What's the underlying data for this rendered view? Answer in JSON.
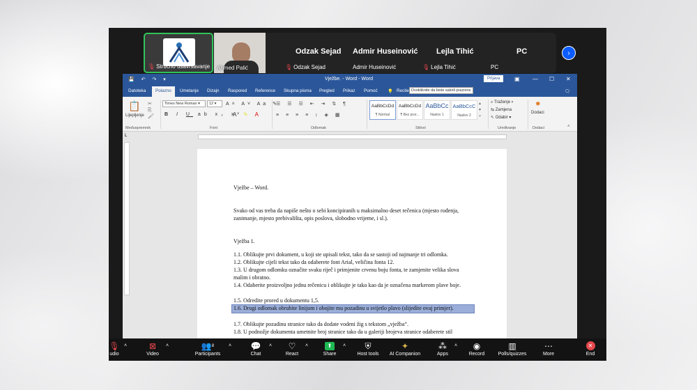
{
  "participants": {
    "tiles": [
      {
        "name": "Stručno usavršavanje"
      },
      {
        "name": "Ahmed Palić"
      }
    ],
    "names_big": [
      "Odzak Sejad",
      "Admir Huseinović",
      "Lejla Tihić",
      "PC"
    ],
    "names_small": [
      "Odzak Sejad",
      "Admir Huseinović",
      "Lejla Tihić",
      "PC"
    ],
    "next_icon": "chevron-right-icon"
  },
  "word": {
    "title": "Vježbe. - Word  -  Word",
    "signin": "Prijava",
    "tabs": [
      "Datoteka",
      "Polazno",
      "Umetanje",
      "Dizajn",
      "Raspored",
      "Reference",
      "Skupna pisma",
      "Pregled",
      "Prikaz",
      "Pomoć",
      "Recite što želite učiniti"
    ],
    "active_tab": "Polazno",
    "ribbon": {
      "paste": "Lijepljenje",
      "font_name": "Times New Roman",
      "font_size": "12",
      "groups": [
        "Međuspremnik",
        "Font",
        "Odlomak",
        "Stilovi",
        "Uređivanje",
        "Dodaci"
      ],
      "styles": [
        {
          "sample": "AaBbCcDd",
          "name": "¶ Normal"
        },
        {
          "sample": "AaBbCcDd",
          "name": "¶ Bez pror..."
        },
        {
          "sample": "AaBbCc",
          "name": "Naslov 1"
        },
        {
          "sample": "AaBbCcC",
          "name": "Naslov 2"
        }
      ],
      "editing": [
        "Traženje",
        "Zamjena",
        "Odabir"
      ],
      "addins": "Dodaci"
    },
    "tooltip": "Dvokliknite da biste sakrili praznine",
    "document": {
      "heading": "Vježbe – Word.",
      "intro": "Svako od vas treba da napiše nešto o sebi koncipiranih u maksimalno deset rečenica (mjesto rođenja, zanimanje, mjesto prebivališta, opis poslova, slobodno vrijeme, i sl.).",
      "section": "Vježba 1.",
      "items": [
        "1.1. Oblikujte prvi dokument, u koji ste upisali tekst, tako da se sastoji od najmanje tri odlomka.",
        "1.2. Oblikujte cijeli tekst tako da odaberete font Arial, veličina fonta 12.",
        "1.3. U drugom odlomku označite svaku riječ i primjenite crvenu boju fonta, te zamjenite velika slova malim i obratno.",
        "1.4. Odaberite proizvoljno jednu rečenicu i oblikujte je tako kao da je označena markerom plave boje.",
        "1.5. Odredite prored u dokumentu 1,5.",
        "1.6. Drugi odlomak obrubite linijom i obojite mu pozadinu u svijetlo plavo (slijedite ovaj primjer).",
        "1.7. Oblikujte pozadinu stranice tako da dodate vodeni žig s tekstom „vježba“.",
        "1.8. U podnožje dokumenta umetnite broj stranice tako da u galeriji brojeva stranice odaberete stil"
      ]
    }
  },
  "toolbar": {
    "audio": "udio",
    "video": "Video",
    "participants": "Participants",
    "participants_count": "8",
    "chat": "Chat",
    "react": "React",
    "share": "Share",
    "host_tools": "Host tools",
    "ai": "AI Companion",
    "apps": "Apps",
    "record": "Record",
    "polls": "Polls/quizzes",
    "more": "More",
    "end": "End"
  },
  "colors": {
    "word_blue": "#2b579a",
    "zoom_green": "#2fc45a",
    "end_red": "#e5484d",
    "highlight": "#9aaed9"
  }
}
